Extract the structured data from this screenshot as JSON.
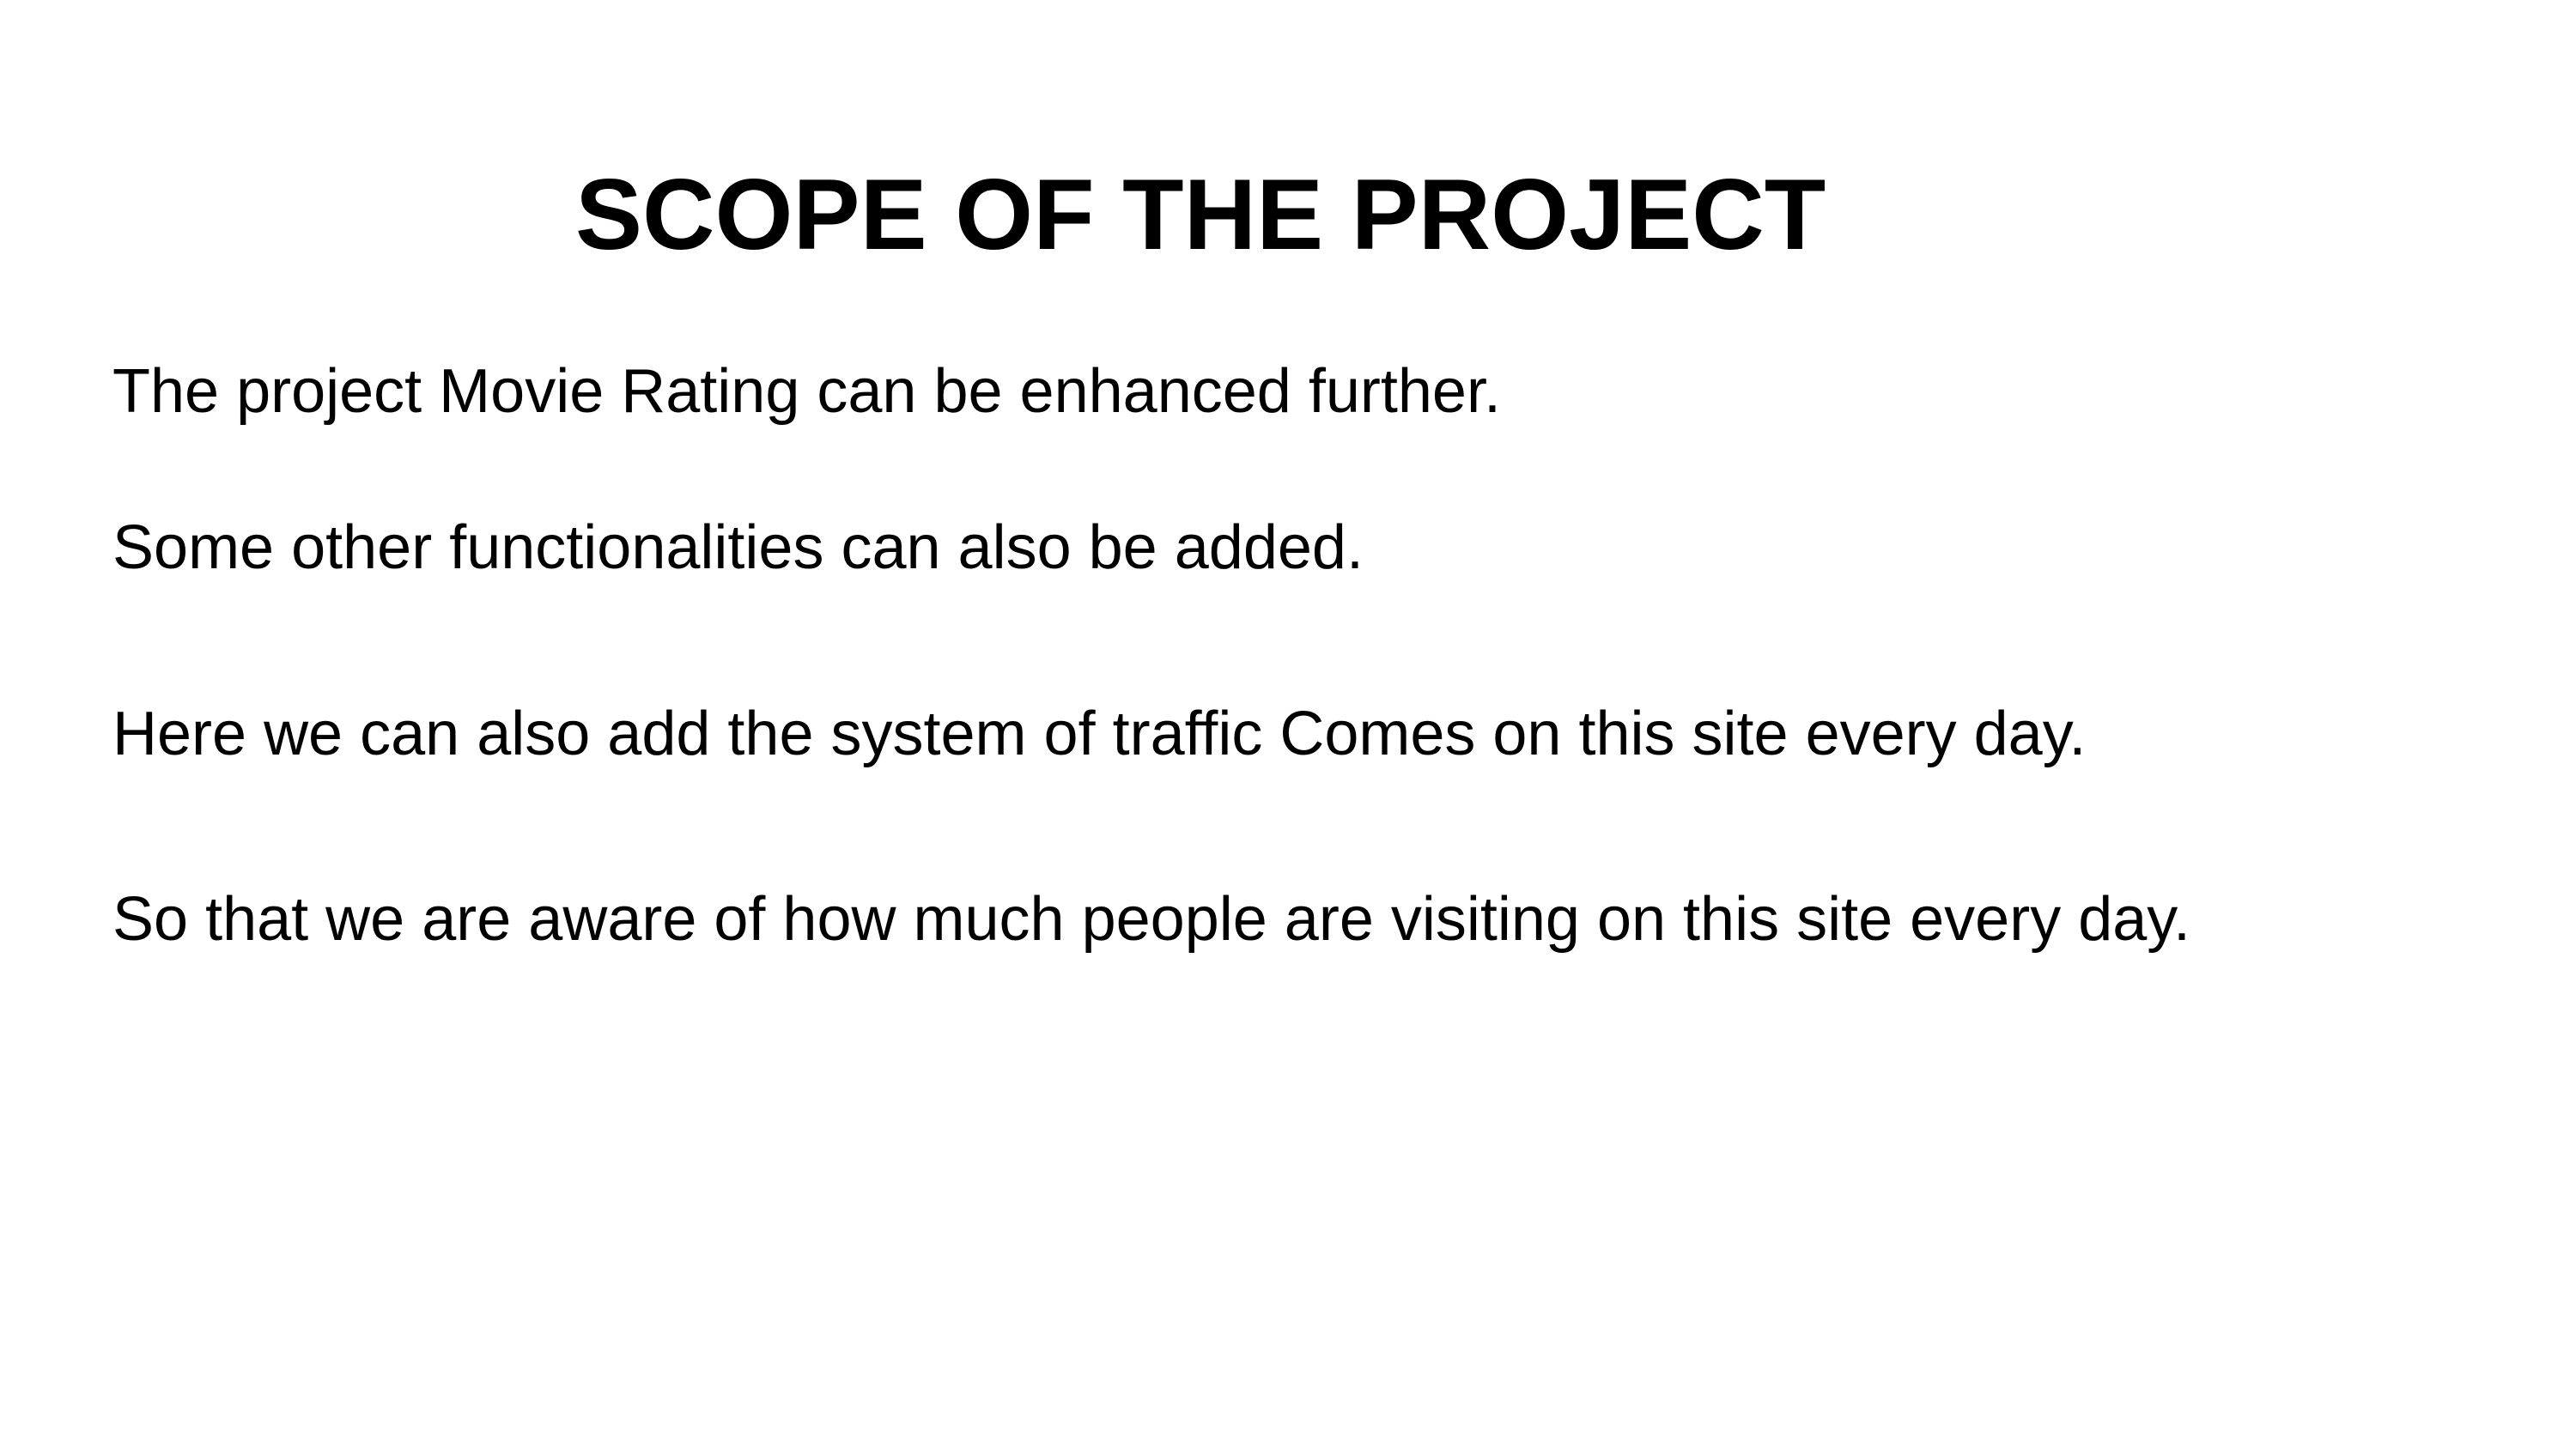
{
  "slide": {
    "title": "SCOPE OF THE PROJECT",
    "lines": [
      "The project Movie Rating can be enhanced further.",
      "Some other functionalities can also be added.",
      "Here we can also add the system of traffic Comes on this site every day.",
      "So that we are aware of how much people are visiting on this site every day."
    ]
  }
}
